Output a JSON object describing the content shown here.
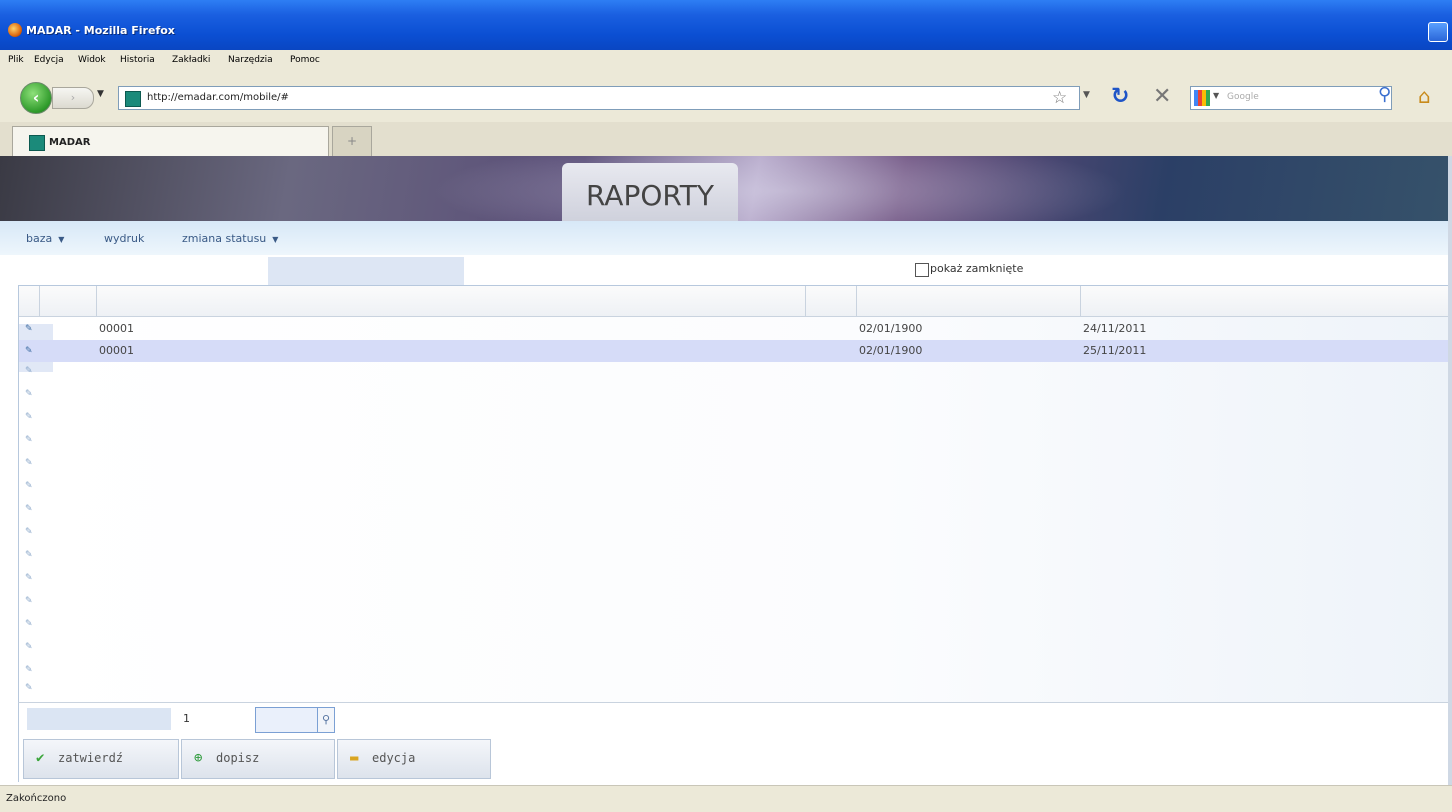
{
  "window": {
    "title": "MADAR - Mozilla Firefox"
  },
  "menu": [
    "Plik",
    "Edycja",
    "Widok",
    "Historia",
    "Zakładki",
    "Narzędzia",
    "Pomoc"
  ],
  "nav": {
    "url": "http://emadar.com/mobile/#",
    "search_placeholder": "Google"
  },
  "tab": {
    "title": "MADAR",
    "newtab": "+"
  },
  "banner": {
    "heading": "RAPORTY"
  },
  "appmenu": {
    "baza": "baza",
    "wydruk": "wydruk",
    "zmiana": "zmiana statusu",
    "arrow": "▼"
  },
  "filter": {
    "show_closed_label": "pokaż zamknięte"
  },
  "rows": [
    {
      "id": "00001",
      "date1": "02/01/1900",
      "date2": "24/11/2011"
    },
    {
      "id": "00001",
      "date1": "02/01/1900",
      "date2": "25/11/2011"
    }
  ],
  "pager": {
    "page": "1"
  },
  "actions": {
    "confirm": "zatwierdź",
    "add": "dopisz",
    "edit": "edycja"
  },
  "status": {
    "text": "Zakończono"
  },
  "icons": {
    "row": "row-edit-icon",
    "search": "search-icon",
    "confirm": "check-icon",
    "add": "plus-icon",
    "edit": "folder-icon"
  }
}
